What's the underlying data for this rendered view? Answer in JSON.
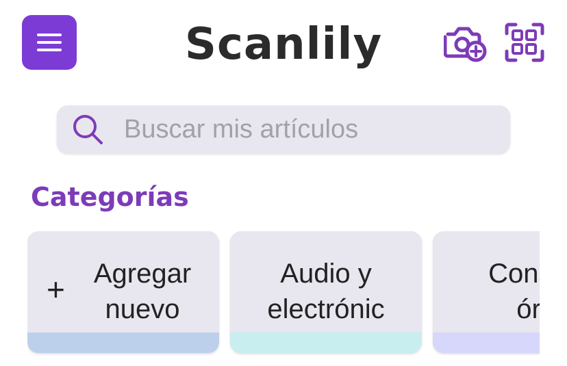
{
  "header": {
    "title": "Scanlily",
    "menu_icon": "hamburger-icon",
    "camera_icon": "camera-add-icon",
    "scan_icon": "qr-scan-icon",
    "accent_color": "#7d3bd6"
  },
  "search": {
    "placeholder": "Buscar mis artículos",
    "value": "",
    "icon": "search-icon"
  },
  "categories": {
    "title": "Categorías",
    "items": [
      {
        "label": "Agregar\nnuevo",
        "icon": "plus-icon",
        "strip_color": "#bcd0ec"
      },
      {
        "label": "Audio y\nelectrónic",
        "strip_color": "#c8eef0"
      },
      {
        "label": "Constr\nór",
        "strip_color": "#d7d6fb"
      }
    ]
  }
}
